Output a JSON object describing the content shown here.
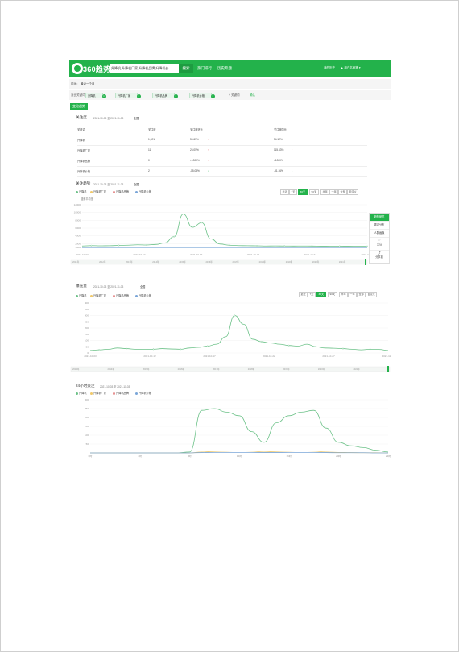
{
  "header": {
    "brand": "360趋势",
    "search_value": "升降机,升降机厂家,升降机品牌,升降机价",
    "search_button": "搜索",
    "nav": [
      "热门排行",
      "历史专题"
    ],
    "my_history": "我的历史",
    "user": "▲ 用户名称等 ▾"
  },
  "filter": {
    "time_label": "时间：",
    "time_value": "最近一个月",
    "compare_label": "对比关键词：",
    "chips": [
      "升降机",
      "升降机厂家",
      "升降机品牌",
      "升降机价格"
    ],
    "add_keyword": "+ 关键词",
    "confirm": "确认"
  },
  "section_tab": "变化趋势",
  "attention": {
    "title": "关注度",
    "date_range": "2021-10-03 至 2021-11-03",
    "scope": "全国",
    "columns": [
      "关键词",
      "关注度",
      "关注度环比",
      "关注度同比"
    ],
    "rows": [
      {
        "kw": "升降机",
        "value": "1,121",
        "mom": "59.65%",
        "mom_dir": "↑",
        "yoy": "54.12%",
        "yoy_dir": "↑"
      },
      {
        "kw": "升降机厂家",
        "value": "11",
        "mom": "25.05%",
        "mom_dir": "↑",
        "yoy": "115.63%",
        "yoy_dir": "↑"
      },
      {
        "kw": "升降机品牌",
        "value": "0",
        "mom": ">1000%",
        "mom_dir": "↑",
        "yoy": ">1000%",
        "yoy_dir": "↑"
      },
      {
        "kw": "升降机价格",
        "value": "2",
        "mom": "-15.08%",
        "mom_dir": "↓",
        "yoy": "-31.16%",
        "yoy_dir": "↓"
      }
    ]
  },
  "trend": {
    "title": "关注趋势",
    "date_range": "2021-10-03 至 2021-11-03",
    "scope": "全国",
    "ranges": [
      "最近",
      "7天",
      "30天",
      "90天",
      "半年",
      "一年",
      "全部",
      "自定义"
    ],
    "active_range": "30天",
    "ylabel": "搜索平均值",
    "year_ticks": [
      "2011年",
      "2012年",
      "2013年",
      "2014年",
      "2015年",
      "2016年",
      "2017年",
      "2018年",
      "2019年",
      "2020年",
      "2021年"
    ]
  },
  "media": {
    "title": "曝光量",
    "date_range": "2021-10-03 至 2021-11-03",
    "scope": "全国",
    "ranges": [
      "最近",
      "7天",
      "30天",
      "90天",
      "半年",
      "一年",
      "全部",
      "自定义"
    ],
    "active_range": "30天",
    "year_ticks": [
      "2013年",
      "2014年",
      "2015年",
      "2016年",
      "2017年",
      "2018年",
      "2019年",
      "2020年",
      "2021年"
    ]
  },
  "hourly": {
    "title": "24小时关注",
    "date_range": "2021-10-03 至 2021-11-03"
  },
  "legend": [
    "升降机",
    "升降机厂家",
    "升降机品牌",
    "升降机价格"
  ],
  "side_menu": [
    "趋势研究",
    "需求分布",
    "人群画像",
    "关注",
    "分享到"
  ],
  "colors": {
    "brand": "#23b24b",
    "series": [
      "#6dc289",
      "#f0c96a",
      "#e58f8f",
      "#7aa6d8"
    ],
    "up": "#e04848",
    "down": "#23b24b"
  },
  "chart_data": [
    {
      "type": "line",
      "title": "关注趋势",
      "ylim": [
        0,
        12000
      ],
      "yticks": [
        "12000",
        "10000",
        "8000",
        "6000",
        "4000",
        "2000",
        "1000"
      ],
      "x": [
        "2021-10-03",
        "2021-10-10",
        "2021-10-17",
        "2021-10-24",
        "2021-10-31",
        "2021-11-03"
      ],
      "series": [
        {
          "name": "升降机",
          "values": [
            1400,
            1500,
            1450,
            1480,
            1550,
            1600,
            1700,
            1650,
            1800,
            2200,
            3800,
            9600,
            6200,
            7400,
            3200,
            1900,
            1600,
            1500,
            1480,
            1450,
            1400,
            1420,
            1400,
            1380,
            1400,
            1380,
            1360,
            1350,
            1340,
            1330,
            1320,
            1310
          ]
        },
        {
          "name": "升降机价格",
          "values": [
            1000,
            1000,
            1000,
            1000,
            1000,
            1000,
            1000,
            1000,
            1000,
            1000,
            1000,
            1000,
            1000,
            1000,
            1000,
            1000,
            1000,
            1000,
            1000,
            1000,
            1000,
            1000,
            1000,
            1000,
            1000,
            1000,
            1000,
            1000,
            1000,
            1000,
            1000,
            1000
          ]
        }
      ]
    },
    {
      "type": "line",
      "title": "曝光量",
      "ylim": [
        0,
        400
      ],
      "yticks": [
        "400",
        "350",
        "300",
        "250",
        "200",
        "150",
        "100",
        "50",
        "0"
      ],
      "x": [
        "2021-10-03",
        "2021-10-12",
        "2021-10-17",
        "2021-10-22",
        "2021-10-27",
        "2021-11-03"
      ],
      "series": [
        {
          "name": "升降机",
          "values": [
            20,
            25,
            30,
            40,
            35,
            30,
            28,
            30,
            35,
            32,
            30,
            40,
            45,
            55,
            70,
            130,
            300,
            230,
            110,
            90,
            80,
            70,
            60,
            55,
            70,
            50,
            40,
            38,
            35,
            30,
            25,
            30,
            28,
            20
          ]
        }
      ]
    },
    {
      "type": "line",
      "title": "24小时关注",
      "ylim": [
        0,
        300
      ],
      "yticks": [
        "300",
        "250",
        "200",
        "150",
        "100",
        "50"
      ],
      "x": [
        "0时",
        "4时",
        "8时",
        "12时",
        "16时",
        "20时",
        "24时"
      ],
      "series": [
        {
          "name": "升降机",
          "values": [
            0,
            0,
            0,
            0,
            0,
            0,
            0,
            0,
            5,
            240,
            250,
            230,
            210,
            120,
            60,
            170,
            210,
            230,
            240,
            140,
            60,
            40,
            30,
            15,
            5
          ]
        },
        {
          "name": "升降机厂家",
          "values": [
            0,
            0,
            0,
            0,
            0,
            0,
            0,
            0,
            0,
            5,
            8,
            10,
            12,
            10,
            5,
            8,
            10,
            12,
            10,
            5,
            3,
            2,
            1,
            1,
            0
          ]
        },
        {
          "name": "升降机价格",
          "values": [
            0,
            0,
            0,
            0,
            0,
            0,
            0,
            0,
            0,
            2,
            3,
            3,
            3,
            3,
            2,
            2,
            3,
            3,
            3,
            2,
            1,
            1,
            1,
            0,
            0
          ]
        }
      ]
    }
  ]
}
